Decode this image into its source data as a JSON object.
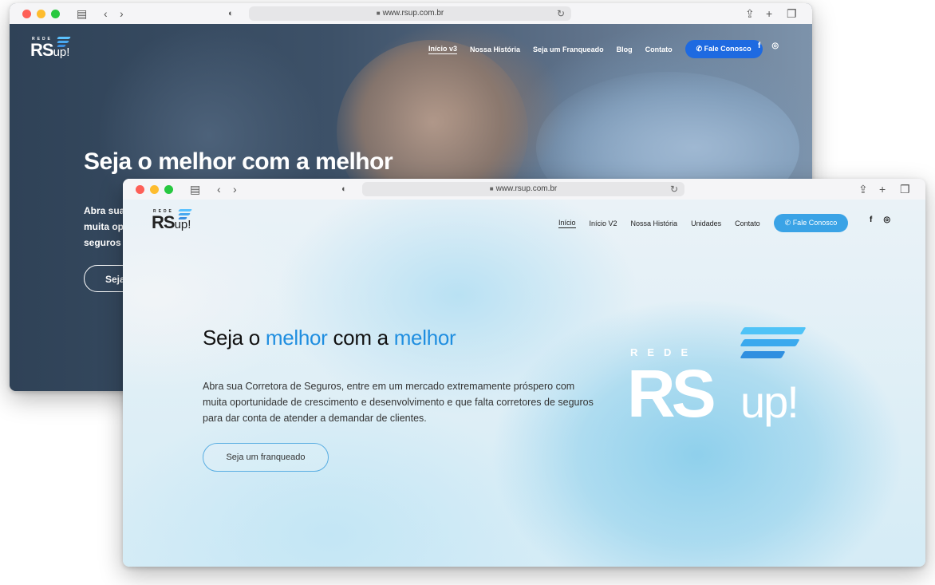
{
  "back_window": {
    "url": "www.rsup.com.br",
    "logo": {
      "rede": "REDE",
      "rs": "RS",
      "up": "up!"
    },
    "nav": [
      "Início v3",
      "Nossa História",
      "Seja um Franqueado",
      "Blog",
      "Contato"
    ],
    "cta": "Fale Conosco",
    "social": {
      "facebook": "f",
      "instagram": "◎"
    },
    "hero_title": "Seja o melhor com a melhor",
    "hero_text_lines": [
      "Abra sua",
      "muita op",
      "seguros"
    ],
    "hero_button": "Seja"
  },
  "front_window": {
    "url": "www.rsup.com.br",
    "logo": {
      "rede": "REDE",
      "rs": "RS",
      "up": "up!"
    },
    "nav": [
      "Início",
      "Início V2",
      "Nossa História",
      "Unidades",
      "Contato"
    ],
    "cta": "Fale Conosco",
    "social": {
      "facebook": "f",
      "instagram": "◎"
    },
    "hero_title": {
      "w1": "Seja o ",
      "w2": "melhor",
      "w3": " com a ",
      "w4": "melhor"
    },
    "hero_text": "Abra sua Corretora de Seguros, entre em um mercado extremamente próspero com muita oportunidade de crescimento e desenvolvimento e que falta corretores de seguros para dar conta de atender a demandar de clientes.",
    "hero_button": "Seja um franqueado",
    "big_logo": {
      "rede": "REDE",
      "rs": "RS",
      "up": "up!"
    }
  },
  "colors": {
    "accent_blue": "#1f8ee0",
    "cta_back": "#1e6ae1",
    "cta_front": "#3aa3e6"
  }
}
